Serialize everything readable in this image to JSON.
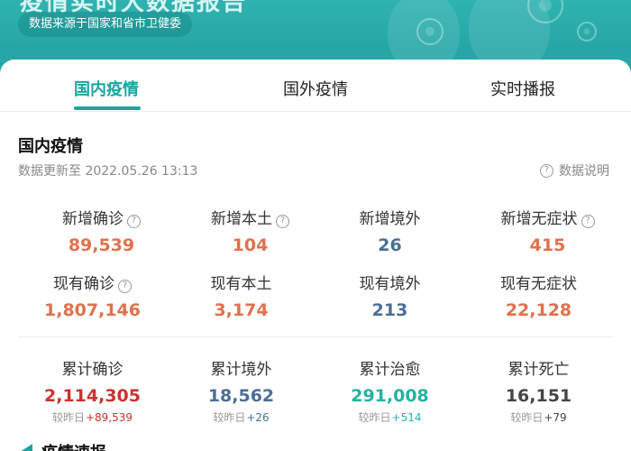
{
  "banner": {
    "title": "疫情实时大数据报告",
    "source": "数据来源于国家和省市卫健委"
  },
  "tabs": [
    {
      "label": "国内疫情"
    },
    {
      "label": "国外疫情"
    },
    {
      "label": "实时播报"
    }
  ],
  "section": {
    "title": "国内疫情",
    "update_time": "数据更新至 2022.05.26 13:13",
    "data_note": "数据说明"
  },
  "colors": {
    "accent": "#1aa59f",
    "orange": "#e0714d",
    "blue": "#4a6f96",
    "red": "#c8332f",
    "teal": "#25b2a0",
    "dark": "#444444"
  },
  "row1": [
    {
      "label": "新增确诊",
      "value": "89,539",
      "help": true
    },
    {
      "label": "新增本土",
      "value": "104",
      "help": true
    },
    {
      "label": "新增境外",
      "value": "26",
      "help": false
    },
    {
      "label": "新增无症状",
      "value": "415",
      "help": true
    }
  ],
  "row2": [
    {
      "label": "现有确诊",
      "value": "1,807,146",
      "help": true
    },
    {
      "label": "现有本土",
      "value": "3,174",
      "help": false
    },
    {
      "label": "现有境外",
      "value": "213",
      "help": false
    },
    {
      "label": "现有无症状",
      "value": "22,128",
      "help": false
    }
  ],
  "row3": [
    {
      "label": "累计确诊",
      "value": "2,114,305",
      "delta_prefix": "较昨日",
      "delta": "+89,539"
    },
    {
      "label": "累计境外",
      "value": "18,562",
      "delta_prefix": "较昨日",
      "delta": "+26"
    },
    {
      "label": "累计治愈",
      "value": "291,008",
      "delta_prefix": "较昨日",
      "delta": "+514"
    },
    {
      "label": "累计死亡",
      "value": "16,151",
      "delta_prefix": "较昨日",
      "delta": "+79"
    }
  ],
  "news": {
    "title": "疫情速报"
  },
  "icons": {
    "help": "question-circle-icon",
    "news": "triangle-flag-icon"
  }
}
